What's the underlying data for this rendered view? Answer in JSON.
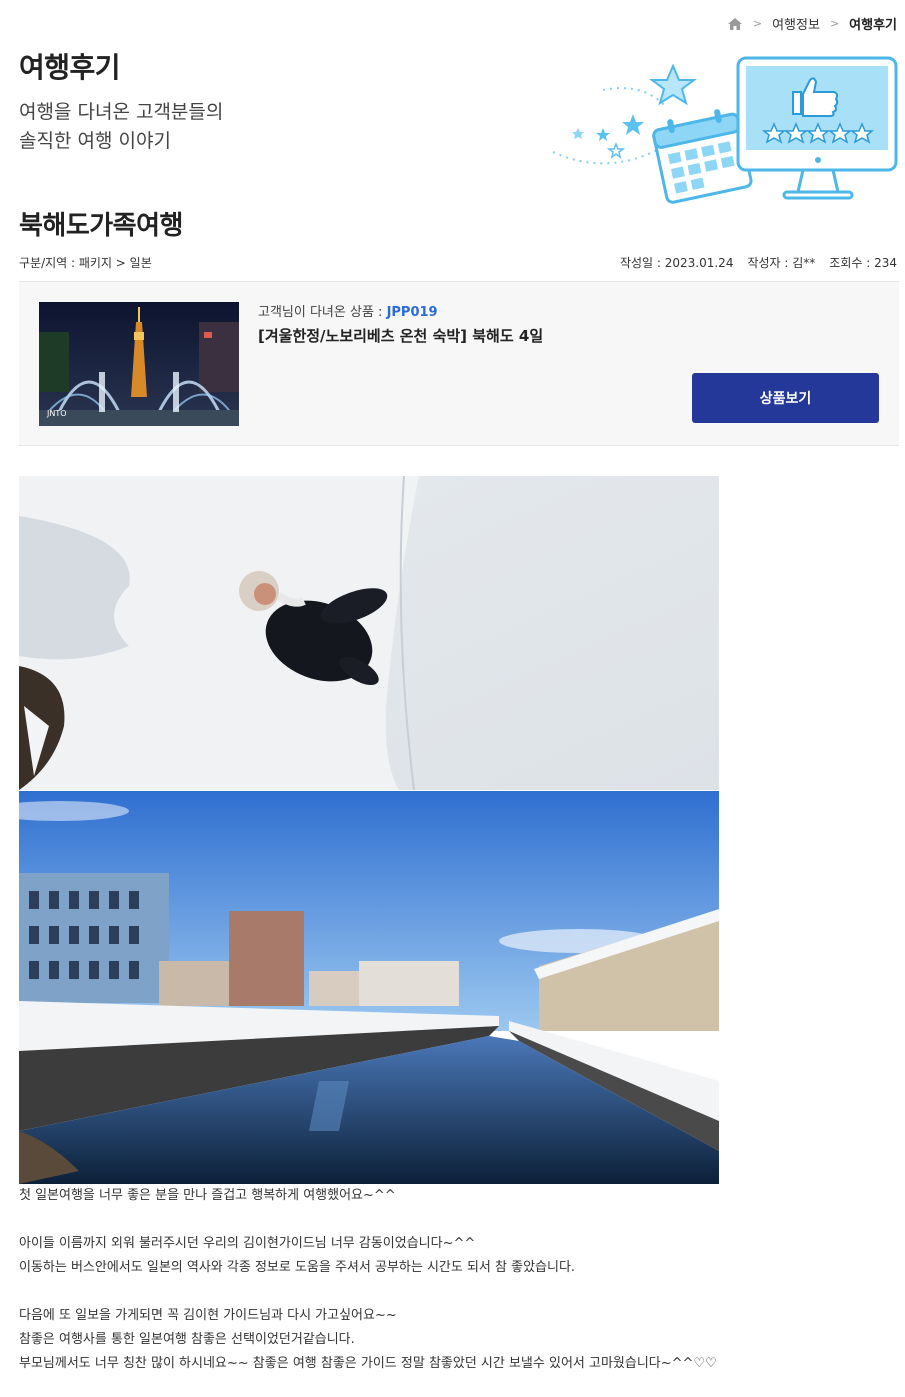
{
  "breadcrumb": {
    "items": [
      "여행정보",
      "여행후기"
    ]
  },
  "header": {
    "title": "여행후기",
    "subtitle_line1": "여행을 다녀온 고객분들의",
    "subtitle_line2": "솔직한 여행 이야기"
  },
  "post": {
    "title": "북해도가족여행",
    "category": "구분/지역 : 패키지 > 일본",
    "date": "작성일 : 2023.01.24",
    "author": "작성자 : 김**",
    "views": "조회수 : 234"
  },
  "product": {
    "label": "고객님이 다녀온 상품 : ",
    "code": "JPP019",
    "name": "[겨울한정/노보리베츠 온천 숙박] 북해도 4일",
    "button_label": "상품보기",
    "image_watermark": "JNTO"
  },
  "content": {
    "lines": [
      " 첫 일본여행을 너무 좋은 분을 만나 즐겁고 행복하게 여행했어요~^^",
      "",
      "아이들 이름까지 외워 불러주시던 우리의 김이현가이드님 너무 감동이었습니다~^^",
      "이동하는 버스안에서도 일본의 역사와 각종 정보로 도움을 주셔서 공부하는 시간도 되서 참 좋았습니다.",
      "",
      "다음에 또 일보을 가게되면 꼭 김이현 가이드님과 다시 가고싶어요~~",
      "참좋은 여행사를 통한 일본여행 참좋은 선택이었던거같습니다.",
      "부모님께서도 너무 칭찬 많이 하시네요~~ 참좋은 여행 참좋은 가이드 정말 참좋았던 시간 보낼수 있어서 고마웠습니다~^^♡♡"
    ]
  },
  "colors": {
    "button_bg": "#24389a",
    "code_color": "#2a6bd6",
    "hero_accent": "#5bc2f0"
  },
  "icons": [
    "home-icon",
    "chevron-right-icon",
    "thumbs-up-icon",
    "calendar-icon",
    "star-icon",
    "monitor-icon"
  ]
}
